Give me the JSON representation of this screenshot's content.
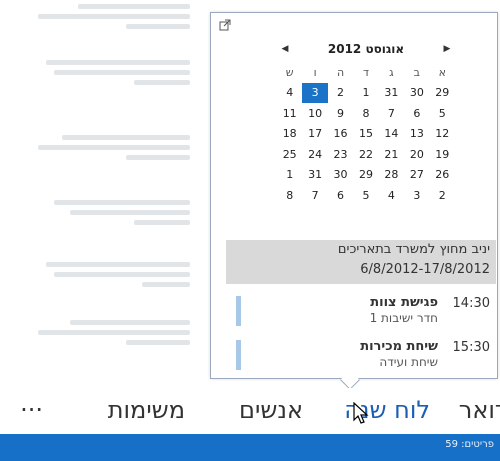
{
  "peek": {
    "month_title": "אוגוסט 2012",
    "weekdays": [
      "א",
      "ב",
      "ג",
      "ד",
      "ה",
      "ו",
      "ש"
    ],
    "weeks": [
      [
        "29",
        "30",
        "31",
        "1",
        "2",
        "3",
        "4"
      ],
      [
        "5",
        "6",
        "7",
        "8",
        "9",
        "10",
        "11"
      ],
      [
        "12",
        "13",
        "14",
        "15",
        "16",
        "17",
        "18"
      ],
      [
        "19",
        "20",
        "21",
        "22",
        "23",
        "24",
        "25"
      ],
      [
        "26",
        "27",
        "28",
        "29",
        "30",
        "31",
        "1"
      ],
      [
        "2",
        "3",
        "4",
        "5",
        "6",
        "7",
        "8"
      ]
    ],
    "vacation": {
      "title": "יניב מחוץ למשרד בתאריכים",
      "dates": "6/8/2012-17/8/2012"
    },
    "appointments": [
      {
        "time": "14:30",
        "title": "פגישת צוות",
        "subtitle": "חדר ישיבות 1"
      },
      {
        "time": "15:30",
        "title": "שיחת מכירות",
        "subtitle": "שיחת ועידה"
      }
    ],
    "accent": "#1a73c7"
  },
  "nav": {
    "items": [
      {
        "label": "דואר",
        "active": false
      },
      {
        "label": "לוח שנה",
        "active": true
      },
      {
        "label": "אנשים",
        "active": false
      },
      {
        "label": "משימות",
        "active": false
      },
      {
        "label": "···",
        "active": false
      }
    ],
    "active_color": "#1a5fb4"
  },
  "status": {
    "text": "פריטים: 59",
    "bar_color": "#1770c8"
  },
  "icons": {
    "popout": "popout-icon",
    "prev": "chevron-left-icon",
    "next": "chevron-right-icon",
    "cursor": "mouse-pointer-icon"
  }
}
